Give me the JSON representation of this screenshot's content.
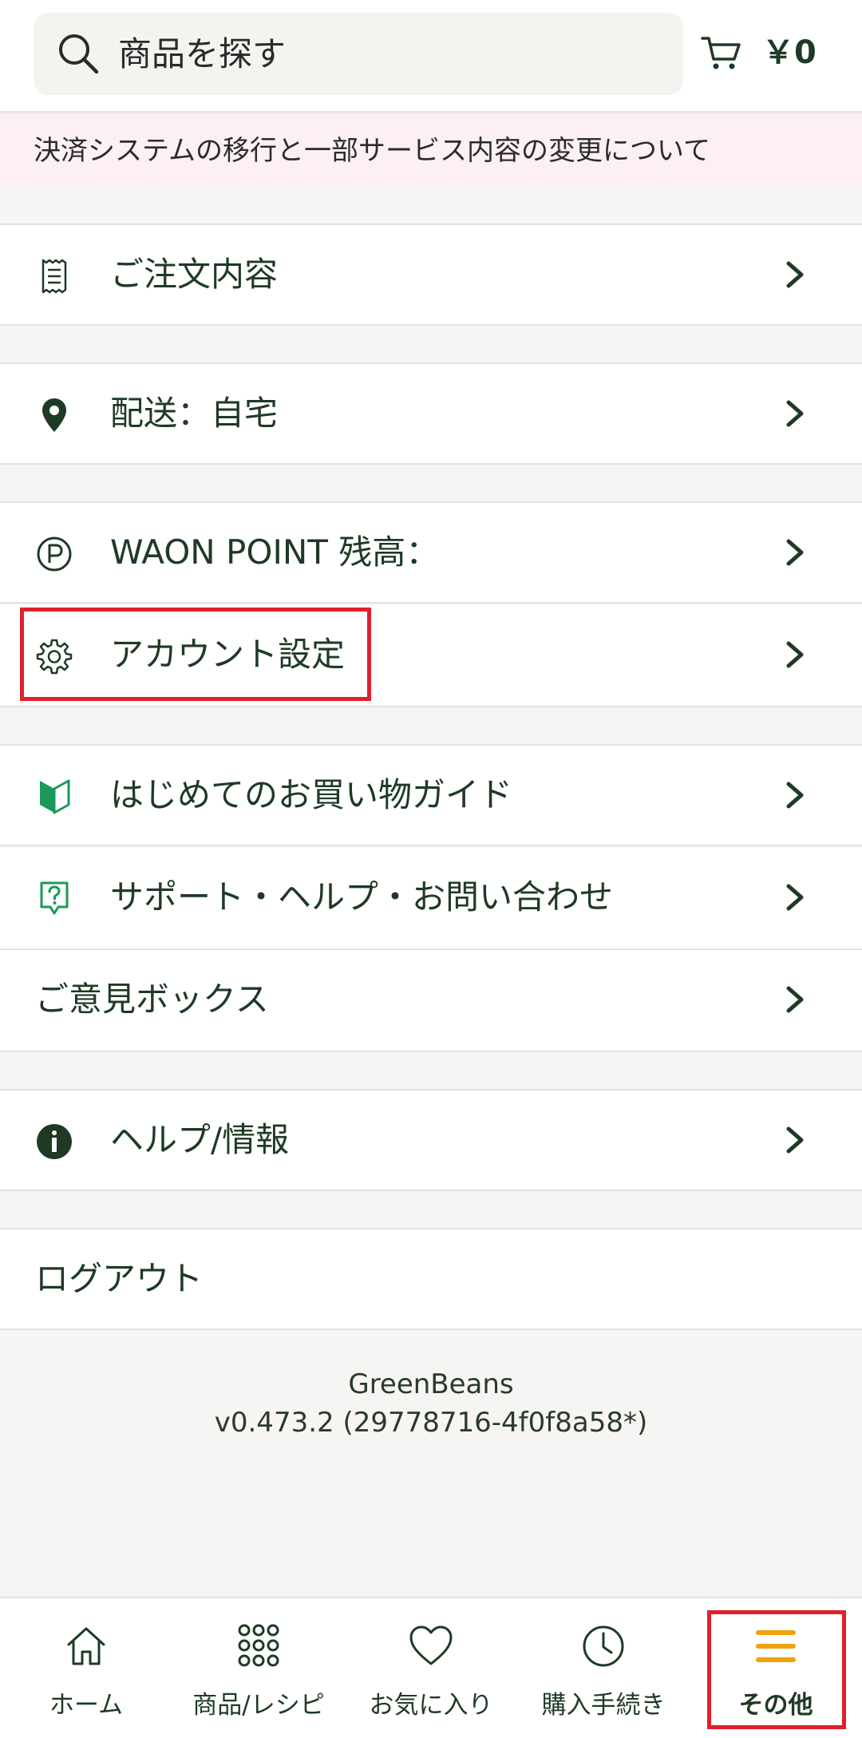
{
  "header": {
    "search_placeholder": "商品を探す",
    "search_icon": "search-icon",
    "cart_icon": "cart-icon",
    "cart_total": "￥0"
  },
  "notice": {
    "text": "決済システムの移行と一部サービス内容の変更について"
  },
  "menu": {
    "orders": {
      "label": "ご注文内容",
      "icon": "receipt-icon"
    },
    "delivery": {
      "label": "配送：自宅",
      "icon": "location-pin-icon"
    },
    "waon": {
      "label": "WAON POINT 残高：",
      "icon": "points-icon"
    },
    "account": {
      "label": "アカウント設定",
      "icon": "gear-icon"
    },
    "guide": {
      "label": "はじめてのお買い物ガイド",
      "icon": "beginner-mark-icon"
    },
    "support": {
      "label": "サポート・ヘルプ・お問い合わせ",
      "icon": "question-bubble-icon"
    },
    "feedback": {
      "label": "ご意見ボックス"
    },
    "help_info": {
      "label": "ヘルプ/情報",
      "icon": "info-icon"
    },
    "logout": {
      "label": "ログアウト"
    }
  },
  "app_info": {
    "name": "GreenBeans",
    "version": "v0.473.2 (29778716-4f0f8a58*)"
  },
  "bottom_nav": {
    "home": {
      "label": "ホーム",
      "icon": "home-icon"
    },
    "products": {
      "label": "商品/レシピ",
      "icon": "grid-icon"
    },
    "favorites": {
      "label": "お気に入り",
      "icon": "heart-icon"
    },
    "history": {
      "label": "購入手続き",
      "icon": "clock-icon"
    },
    "more": {
      "label": "その他",
      "icon": "menu-icon",
      "active": true
    }
  },
  "colors": {
    "primary": "#1e3a24",
    "accent": "#f0a30a",
    "highlight": "#e0202c",
    "guide_green": "#1a9a5a",
    "notice_bg": "#fdf0f2"
  }
}
